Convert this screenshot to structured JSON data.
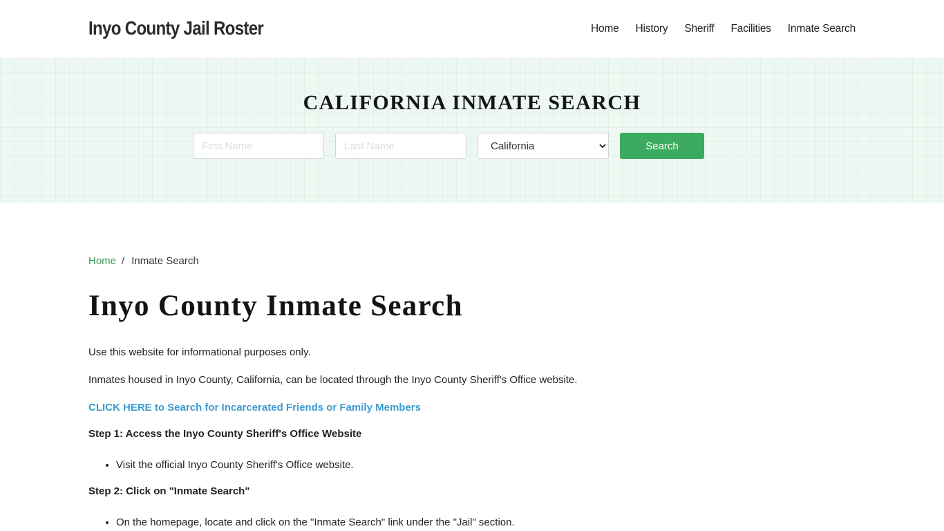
{
  "header": {
    "brand": "Inyo County Jail Roster",
    "nav": [
      {
        "label": "Home"
      },
      {
        "label": "History"
      },
      {
        "label": "Sheriff"
      },
      {
        "label": "Facilities"
      },
      {
        "label": "Inmate Search"
      }
    ]
  },
  "hero": {
    "title": "CALIFORNIA INMATE SEARCH",
    "first_name_placeholder": "First Name",
    "first_name_value": "",
    "last_name_placeholder": "Last Name",
    "last_name_value": "",
    "state_selected": "California",
    "search_label": "Search",
    "colors": {
      "button": "#3cab5f",
      "background": "#eef8f2"
    }
  },
  "breadcrumb": {
    "home": "Home",
    "separator": "/",
    "current": "Inmate Search"
  },
  "main": {
    "title": "Inyo County Inmate Search",
    "intro": "Use this website for informational purposes only.",
    "paragraph": "Inmates housed in Inyo County, California, can be located through the Inyo County Sheriff's Office website.",
    "cta_link": "CLICK HERE to Search for Incarcerated Friends or Family Members",
    "steps": [
      {
        "heading": "Step 1: Access the Inyo County Sheriff's Office Website",
        "bullets": [
          "Visit the official Inyo County Sheriff's Office website."
        ]
      },
      {
        "heading": "Step 2: Click on \"Inmate Search\"",
        "bullets": [
          "On the homepage, locate and click on the \"Inmate Search\" link under the \"Jail\" section."
        ]
      }
    ],
    "colors": {
      "link": "#3d9bd1",
      "breadcrumb_link": "#3c9a5a"
    }
  }
}
